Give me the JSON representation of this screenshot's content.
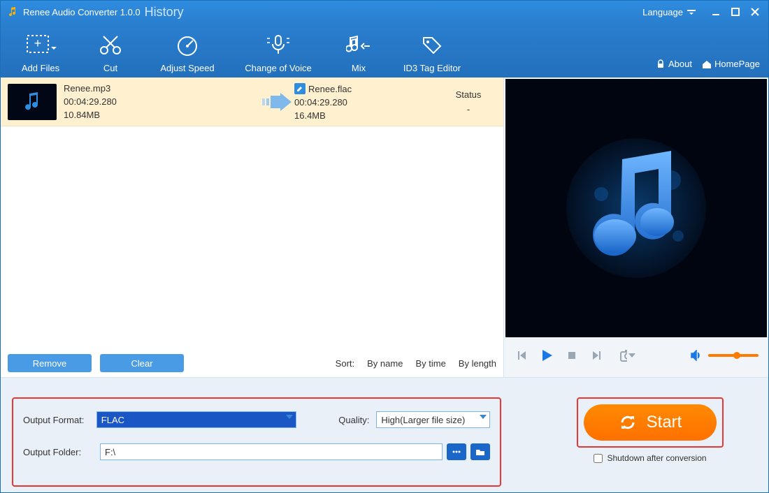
{
  "title": "Renee Audio Converter 1.0.0",
  "history": "History",
  "language_label": "Language",
  "toolbar": {
    "add_files": "Add Files",
    "cut": "Cut",
    "adjust_speed": "Adjust Speed",
    "change_voice": "Change of Voice",
    "mix": "Mix",
    "id3": "ID3 Tag Editor",
    "about": "About",
    "homepage": "HomePage"
  },
  "file": {
    "src_name": "Renee.mp3",
    "src_duration": "00:04:29.280",
    "src_size": "10.84MB",
    "dst_name": "Renee.flac",
    "dst_duration": "00:04:29.280",
    "dst_size": "16.4MB",
    "status_label": "Status",
    "status_value": "-"
  },
  "buttons": {
    "remove": "Remove",
    "clear": "Clear"
  },
  "sort": {
    "label": "Sort:",
    "by_name": "By name",
    "by_time": "By time",
    "by_length": "By length"
  },
  "output": {
    "format_label": "Output Format:",
    "format_value": "FLAC",
    "quality_label": "Quality:",
    "quality_value": "High(Larger file size)",
    "folder_label": "Output Folder:",
    "folder_value": "F:\\"
  },
  "start_label": "Start",
  "shutdown_label": "Shutdown after conversion"
}
